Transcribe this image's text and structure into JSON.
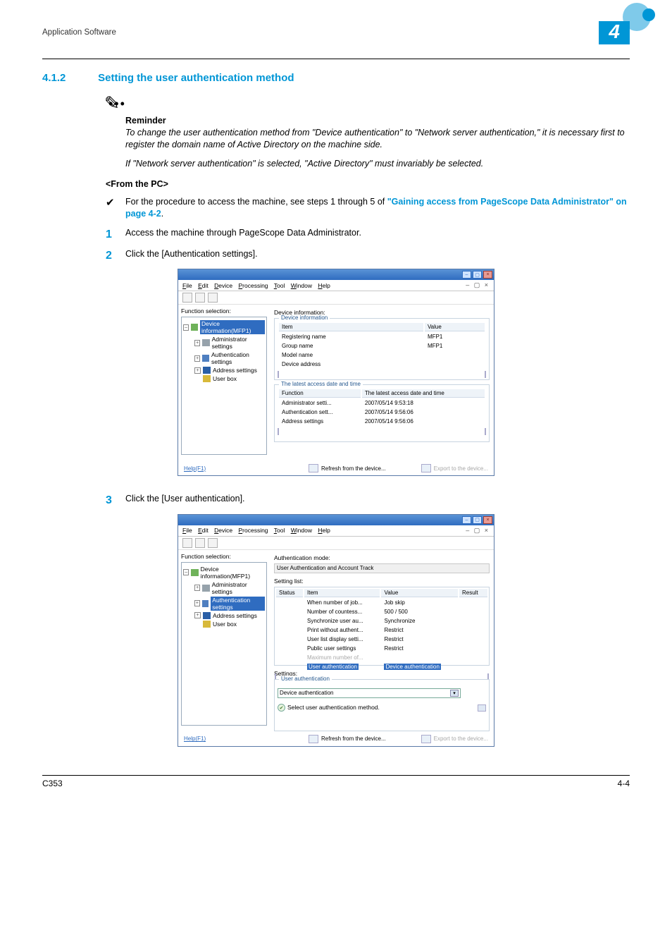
{
  "header": {
    "breadcrumb": "Application Software",
    "chapter_num": "4"
  },
  "section": {
    "number": "4.1.2",
    "title": "Setting the user authentication method"
  },
  "reminder": {
    "label": "Reminder",
    "para1": "To change the user authentication method from \"Device authentication\" to \"Network server authentication,\" it is necessary first to register the domain name of Active Directory on the machine side.",
    "para2": "If \"Network server authentication\" is selected, \"Active Directory\" must invariably be selected."
  },
  "subhead_pc": "<From the PC>",
  "bullet_text_pre": "For the procedure to access the machine, see steps 1 through 5 of ",
  "bullet_link": "\"Gaining access from PageScope Data Administrator\" on page 4-2",
  "bullet_text_post": ".",
  "steps": {
    "s1_num": "1",
    "s1_text": "Access the machine through PageScope Data Administrator.",
    "s2_num": "2",
    "s2_text": "Click the [Authentication settings].",
    "s3_num": "3",
    "s3_text": "Click the [User authentication]."
  },
  "app_common": {
    "menu": {
      "file": "File",
      "edit": "Edit",
      "device": "Device",
      "processing": "Processing",
      "tool": "Tool",
      "window": "Window",
      "help": "Help"
    },
    "win_btns": "– ▢ ×",
    "func_sel": "Function selection:",
    "tree": {
      "root": "Device information(MFP1)",
      "admin": "Administrator settings",
      "auth": "Authentication settings",
      "addr": "Address settings",
      "userbox": "User box"
    },
    "bottom_help": "Help(F1)",
    "refresh": "Refresh from the device...",
    "export": "Export to the device..."
  },
  "app1": {
    "right_title": "Device information:",
    "group1_label": "Device information",
    "g1": {
      "h_item": "Item",
      "h_value": "Value",
      "r1_i": "Registering name",
      "r1_v": "MFP1",
      "r2_i": "Group name",
      "r2_v": "MFP1",
      "r3_i": "Model name",
      "r3_v": "",
      "r4_i": "Device address",
      "r4_v": ""
    },
    "group2_label": "The latest access date and time",
    "g2": {
      "h_func": "Function",
      "h_time": "The latest access date and time",
      "r1_f": "Administrator setti...",
      "r1_t": "2007/05/14 9:53:18",
      "r2_f": "Authentication sett...",
      "r2_t": "2007/05/14 9:56:06",
      "r3_f": "Address settings",
      "r3_t": "2007/05/14 9:56:06"
    }
  },
  "app2": {
    "right_title": "Authentication mode:",
    "mode_value": "User Authentication and Account Track",
    "setting_list": "Setting list:",
    "tbl": {
      "h_status": "Status",
      "h_item": "Item",
      "h_value": "Value",
      "h_result": "Result",
      "r1_i": "When number of job...",
      "r1_v": "Job skip",
      "r2_i": "Number of countess...",
      "r2_v": "500 / 500",
      "r3_i": "Synchronize user au...",
      "r3_v": "Synchronize",
      "r4_i": "Print without authent...",
      "r4_v": "Restrict",
      "r5_i": "User list display setti...",
      "r5_v": "Restrict",
      "r6_i": "Public user settings",
      "r6_v": "Restrict",
      "r7_i": "Maximum number of...",
      "r7_v": "",
      "hl_i": "User authentication",
      "hl_v": "Device authentication"
    },
    "settings_label": "Settings:",
    "inner_group": "User authentication",
    "select_value": "Device authentication",
    "hint": "Select user authentication method."
  },
  "footer": {
    "left": "C353",
    "right": "4-4"
  }
}
